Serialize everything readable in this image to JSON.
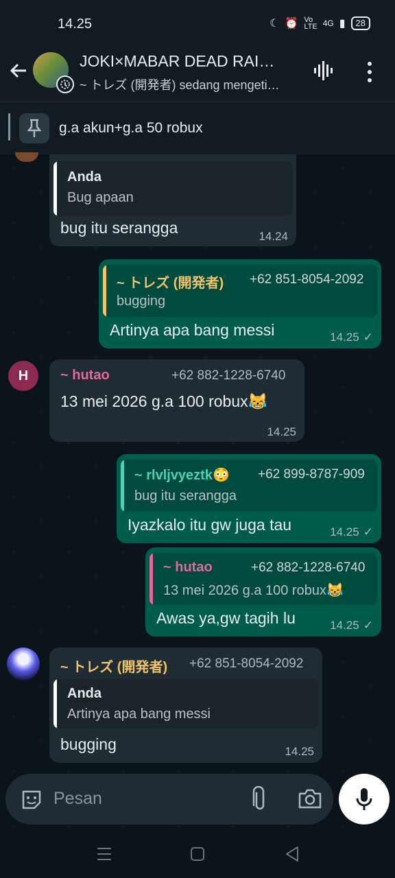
{
  "status_bar": {
    "time": "14.25",
    "network": "4G",
    "battery": "28"
  },
  "header": {
    "title": "JOKI×MABAR DEAD RAI…",
    "subtitle": "~ トレズ (開発者) sedang mengeti…"
  },
  "pinned": {
    "text": "g.a akun+g.a 50 robux"
  },
  "messages": [
    {
      "quote_name": "Anda",
      "quote_text": "Bug apaan",
      "text": "bug itu serangga",
      "time": "14.24"
    },
    {
      "quote_name": "~ トレズ (開発者)",
      "quote_phone": "+62 851-8054-2092",
      "quote_text": "bugging",
      "text": "Artinya apa bang messi",
      "time": "14.25"
    },
    {
      "avatar_letter": "H",
      "sender": "~ hutao",
      "phone": "+62 882-1228-6740",
      "text": "13 mei 2026 g.a 100 robux😹",
      "time": "14.25"
    },
    {
      "quote_name": "~ rlvljvyeztk😳",
      "quote_phone": "+62 899-8787-909",
      "quote_text": "bug itu serangga",
      "text": "Iyazkalo itu gw juga tau",
      "time": "14.25"
    },
    {
      "quote_name": "~ hutao",
      "quote_phone": "+62 882-1228-6740",
      "quote_text": "13 mei 2026 g.a 100 robux😹",
      "text": "Awas ya,gw tagih lu",
      "time": "14.25"
    },
    {
      "sender": "~ トレズ (開発者)",
      "phone": "+62 851-8054-2092",
      "quote_name": "Anda",
      "quote_text": "Artinya apa bang messi",
      "text": "bugging",
      "time": "14.25"
    }
  ],
  "composer": {
    "placeholder": "Pesan"
  },
  "colors": {
    "outgoing": "#005c4b",
    "incoming": "#202c33",
    "accent": "#00a884",
    "hutao": "#e8679a",
    "trez": "#f0c36d",
    "rlv": "#4fd1b0"
  },
  "icons": [
    "back-arrow-icon",
    "voice-chat-icon",
    "more-vert-icon",
    "pin-icon",
    "sticker-icon",
    "attach-icon",
    "camera-icon",
    "mic-icon"
  ]
}
